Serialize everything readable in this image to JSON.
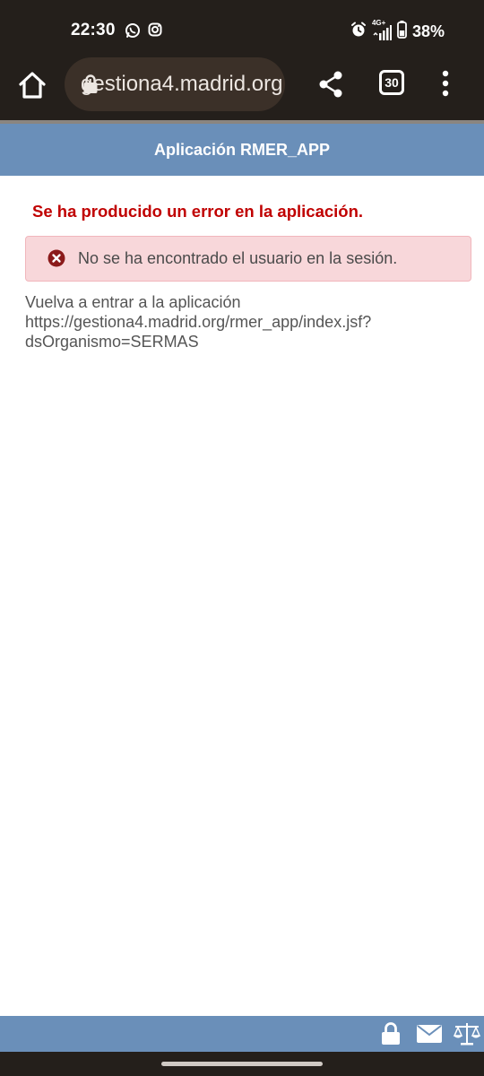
{
  "status_bar": {
    "time": "22:30",
    "battery": "38%",
    "network": "4G+",
    "icons": [
      "whatsapp-icon",
      "instagram-icon",
      "alarm-icon",
      "signal-icon",
      "battery-icon"
    ]
  },
  "browser": {
    "url": "gestiona4.madrid.org",
    "tab_count": "30",
    "icons": [
      "home-icon",
      "lock-icon",
      "share-icon",
      "tabs-icon",
      "more-vert-icon"
    ]
  },
  "app": {
    "title": "Aplicación RMER_APP"
  },
  "content": {
    "error_heading": "Se ha producido un error en la aplicación.",
    "error_message": "No se ha encontrado el usuario en la sesión.",
    "info_lines": [
      "Vuelva a entrar a la aplicación",
      "https://gestiona4.madrid.org/rmer_app/index.jsf?",
      "dsOrganismo=SERMAS"
    ]
  },
  "footer": {
    "icons": [
      "lock-icon",
      "mail-icon",
      "scales-icon"
    ]
  },
  "colors": {
    "system_bar": "#241f1b",
    "app_header": "#6a8fb9",
    "error_red": "#c00000",
    "error_box_bg": "#f8d7da",
    "error_icon": "#8b1a1a"
  }
}
